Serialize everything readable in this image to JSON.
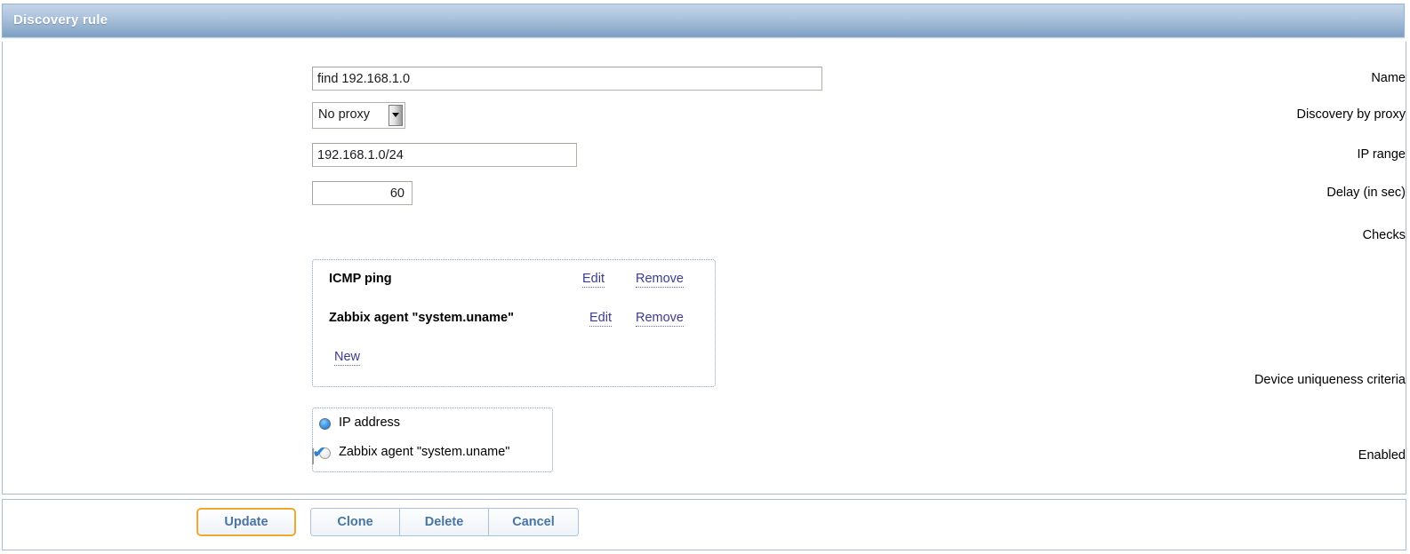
{
  "window": {
    "title": "Discovery rule"
  },
  "form": {
    "name": {
      "label": "Name",
      "value": "find 192.168.1.0"
    },
    "proxy": {
      "label": "Discovery by proxy",
      "value": "No proxy",
      "options": [
        "No proxy"
      ]
    },
    "ip_range": {
      "label": "IP range",
      "value": "192.168.1.0/24"
    },
    "delay": {
      "label": "Delay (in sec)",
      "value": "60"
    },
    "checks": {
      "label": "Checks",
      "items": [
        {
          "name": "ICMP ping",
          "edit_label": "Edit",
          "remove_label": "Remove"
        },
        {
          "name": "Zabbix agent \"system.uname\"",
          "edit_label": "Edit",
          "remove_label": "Remove"
        }
      ],
      "new_label": "New"
    },
    "uniqueness": {
      "label": "Device uniqueness criteria",
      "options": [
        {
          "label": "IP address",
          "selected": true
        },
        {
          "label": "Zabbix agent \"system.uname\"",
          "selected": false
        }
      ]
    },
    "enabled": {
      "label": "Enabled",
      "checked": true,
      "tick": "✔"
    }
  },
  "footer": {
    "update_label": "Update",
    "clone_label": "Clone",
    "delete_label": "Delete",
    "cancel_label": "Cancel"
  },
  "colors": {
    "titlebar_top": "#c3d4e8",
    "titlebar_bottom": "#7e9fc4",
    "link": "#3b3b8f",
    "button_text": "#4a74a2",
    "focus_border": "#f0a830",
    "panel_border": "#a8bdd4",
    "radio_selected": "#3c9cf0",
    "check_tick": "#2e7fd4"
  }
}
